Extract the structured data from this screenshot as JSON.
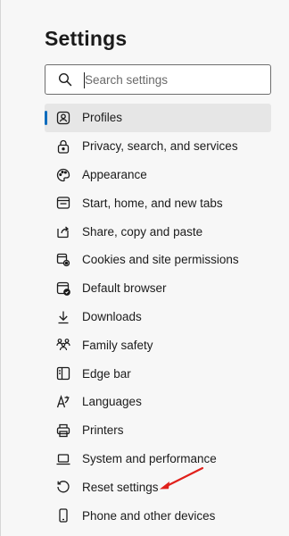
{
  "page": {
    "title": "Settings"
  },
  "search": {
    "placeholder": "Search settings",
    "icon": "search-icon"
  },
  "nav": {
    "items": [
      {
        "label": "Profiles",
        "icon": "profile-icon",
        "active": true
      },
      {
        "label": "Privacy, search, and services",
        "icon": "lock-icon"
      },
      {
        "label": "Appearance",
        "icon": "palette-icon"
      },
      {
        "label": "Start, home, and new tabs",
        "icon": "home-tab-icon"
      },
      {
        "label": "Share, copy and paste",
        "icon": "share-icon"
      },
      {
        "label": "Cookies and site permissions",
        "icon": "cookies-icon"
      },
      {
        "label": "Default browser",
        "icon": "browser-icon"
      },
      {
        "label": "Downloads",
        "icon": "download-icon"
      },
      {
        "label": "Family safety",
        "icon": "family-icon"
      },
      {
        "label": "Edge bar",
        "icon": "edge-bar-icon"
      },
      {
        "label": "Languages",
        "icon": "language-icon"
      },
      {
        "label": "Printers",
        "icon": "printer-icon"
      },
      {
        "label": "System and performance",
        "icon": "laptop-icon"
      },
      {
        "label": "Reset settings",
        "icon": "reset-icon"
      },
      {
        "label": "Phone and other devices",
        "icon": "phone-icon"
      }
    ]
  },
  "annotation": {
    "arrow_color": "#e0201b"
  },
  "colors": {
    "accent": "#0f6cbd",
    "active_bg": "#e6e6e6",
    "background": "#f7f7f7"
  }
}
